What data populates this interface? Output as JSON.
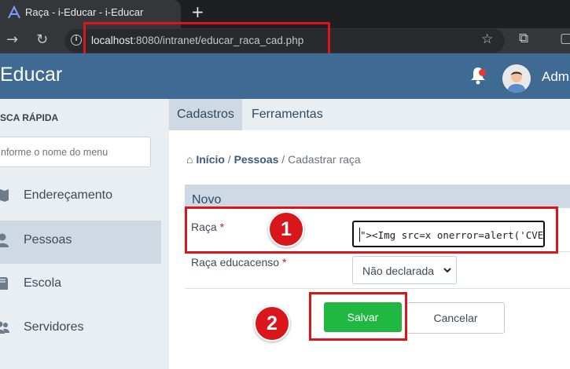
{
  "browser": {
    "tab_title": "Raça - i-Educar - i-Educar",
    "new_tab_label": "+",
    "url_host": "localhost",
    "url_rest": ":8080/intranet/educar_raca_cad.php"
  },
  "header": {
    "app_title": "Educar",
    "user_name": "Adm",
    "notification_color": "#e53935"
  },
  "sidebar": {
    "search_label": "SCA RÁPIDA",
    "search_placeholder": "nforme o nome do menu",
    "items": [
      {
        "label": "Endereçamento",
        "icon": "map-icon",
        "active": false
      },
      {
        "label": "Pessoas",
        "icon": "user-icon",
        "active": true
      },
      {
        "label": "Escola",
        "icon": "book-icon",
        "active": false
      },
      {
        "label": "Servidores",
        "icon": "users-icon",
        "active": false
      }
    ]
  },
  "content": {
    "tabs": [
      "Cadastros",
      "Ferramentas"
    ],
    "breadcrumb": {
      "home": "Início",
      "sep1": " / ",
      "parent": "Pessoas",
      "sep2": " / ",
      "current": "Cadastrar raça"
    },
    "section_title": "Novo",
    "fields": {
      "raca_label": "Raça",
      "raca_value": "\"><Img src=x onerror=alert('CVE-Hu",
      "raca_educacenso_label": "Raça educacenso",
      "raca_educacenso_value": "Não declarada",
      "required_mark": "*"
    },
    "buttons": {
      "save": "Salvar",
      "cancel": "Cancelar"
    }
  },
  "annotations": {
    "badge_1": "1",
    "badge_2": "2",
    "highlight_color": "#d9161c"
  },
  "colors": {
    "header_bg": "#3e6a94",
    "save_button": "#20b840"
  }
}
